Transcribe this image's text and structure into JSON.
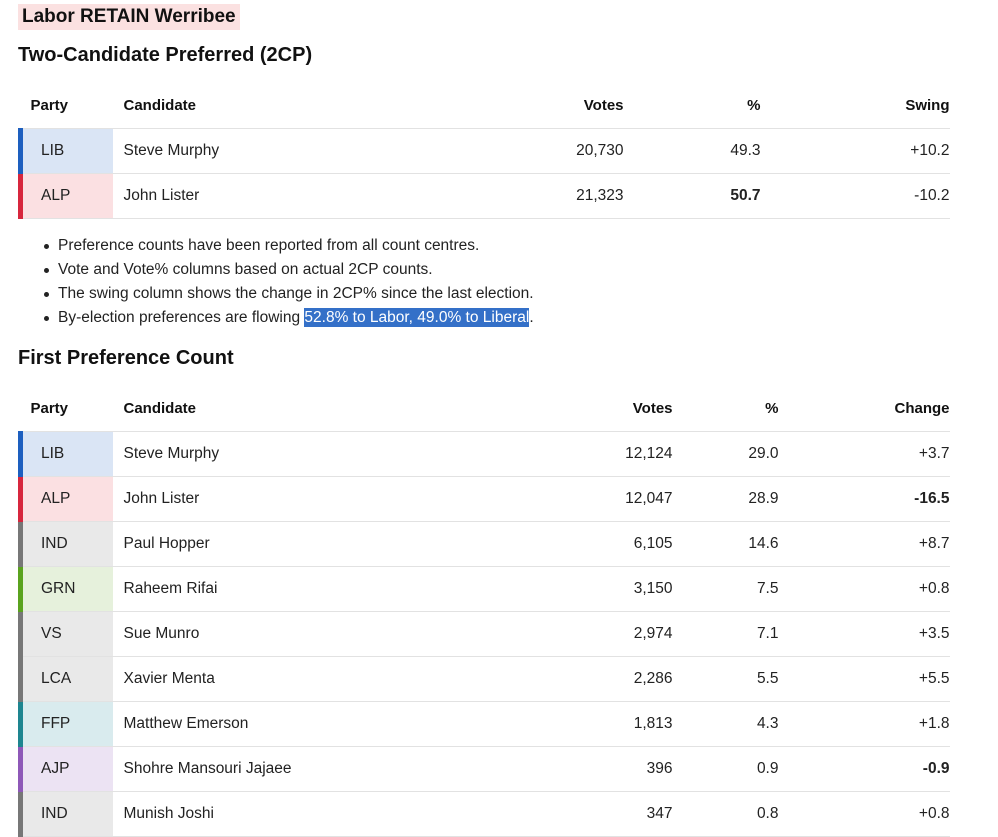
{
  "banner": "Labor RETAIN Werribee",
  "tcp": {
    "title": "Two-Candidate Preferred (2CP)",
    "headers": {
      "party": "Party",
      "candidate": "Candidate",
      "votes": "Votes",
      "pct": "%",
      "swing": "Swing"
    },
    "rows": [
      {
        "party": "LIB",
        "candidate": "Steve Murphy",
        "votes": "20,730",
        "pct": "49.3",
        "swing": "+10.2",
        "color": "#1d5fbf",
        "bg": "#dae5f5",
        "pct_bold": false
      },
      {
        "party": "ALP",
        "candidate": "John Lister",
        "votes": "21,323",
        "pct": "50.7",
        "swing": "-10.2",
        "color": "#d7263d",
        "bg": "#fbe0e2",
        "pct_bold": true
      }
    ]
  },
  "notes": [
    {
      "text": "Preference counts have been reported from all count centres."
    },
    {
      "text": "Vote and Vote% columns based on actual 2CP counts."
    },
    {
      "text": "The swing column shows the change in 2CP% since the last election."
    },
    {
      "text": "By-election preferences are flowing ",
      "highlight": "52.8% to Labor, 49.0% to Liberal",
      "after": "."
    }
  ],
  "fp": {
    "title": "First Preference Count",
    "headers": {
      "party": "Party",
      "candidate": "Candidate",
      "votes": "Votes",
      "pct": "%",
      "change": "Change"
    },
    "rows": [
      {
        "party": "LIB",
        "candidate": "Steve Murphy",
        "votes": "12,124",
        "pct": "29.0",
        "change": "+3.7",
        "color": "#1d5fbf",
        "bg": "#dae5f5",
        "change_bold": false
      },
      {
        "party": "ALP",
        "candidate": "John Lister",
        "votes": "12,047",
        "pct": "28.9",
        "change": "-16.5",
        "color": "#d7263d",
        "bg": "#fbe0e2",
        "change_bold": true
      },
      {
        "party": "IND",
        "candidate": "Paul Hopper",
        "votes": "6,105",
        "pct": "14.6",
        "change": "+8.7",
        "color": "#777777",
        "bg": "#e9e9e9",
        "change_bold": false
      },
      {
        "party": "GRN",
        "candidate": "Raheem Rifai",
        "votes": "3,150",
        "pct": "7.5",
        "change": "+0.8",
        "color": "#5aa31e",
        "bg": "#e6f1dc",
        "change_bold": false
      },
      {
        "party": "VS",
        "candidate": "Sue Munro",
        "votes": "2,974",
        "pct": "7.1",
        "change": "+3.5",
        "color": "#777777",
        "bg": "#e9e9e9",
        "change_bold": false
      },
      {
        "party": "LCA",
        "candidate": "Xavier Menta",
        "votes": "2,286",
        "pct": "5.5",
        "change": "+5.5",
        "color": "#777777",
        "bg": "#e9e9e9",
        "change_bold": false
      },
      {
        "party": "FFP",
        "candidate": "Matthew Emerson",
        "votes": "1,813",
        "pct": "4.3",
        "change": "+1.8",
        "color": "#1e8590",
        "bg": "#d9ebee",
        "change_bold": false
      },
      {
        "party": "AJP",
        "candidate": "Shohre Mansouri Jajaee",
        "votes": "396",
        "pct": "0.9",
        "change": "-0.9",
        "color": "#8e58b8",
        "bg": "#ece3f3",
        "change_bold": true
      },
      {
        "party": "IND",
        "candidate": "Munish Joshi",
        "votes": "347",
        "pct": "0.8",
        "change": "+0.8",
        "color": "#777777",
        "bg": "#e9e9e9",
        "change_bold": false
      }
    ]
  }
}
